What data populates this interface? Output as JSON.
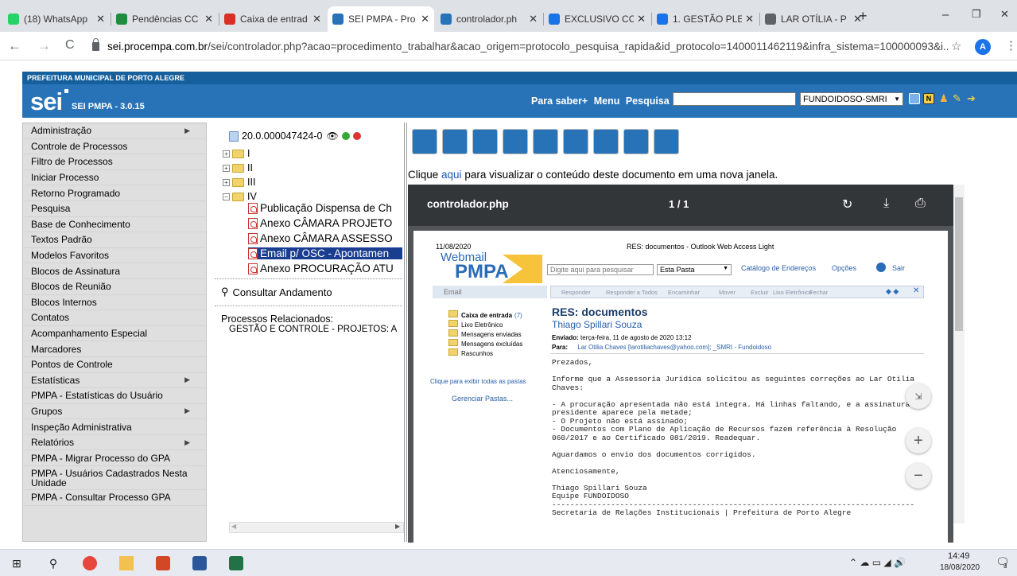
{
  "browser": {
    "tabs": [
      {
        "label": "(18) WhatsApp",
        "icon": "whatsapp-icon",
        "color": "#25d366"
      },
      {
        "label": "Pendências CC",
        "icon": "sheets-icon",
        "color": "#1e8e3e"
      },
      {
        "label": "Caixa de entrad",
        "icon": "gmail-icon",
        "color": "#d93025"
      },
      {
        "label": "SEI PMPA - Pro",
        "icon": "sei-icon",
        "color": "#2873b8"
      },
      {
        "label": "controlador.ph",
        "icon": "sei-icon",
        "color": "#2873b8"
      },
      {
        "label": "EXCLUSIVO CC",
        "icon": "co-icon",
        "color": "#1a73e8"
      },
      {
        "label": "1. GESTÃO PLE",
        "icon": "co-icon",
        "color": "#1a73e8"
      },
      {
        "label": "LAR OTÍLIA - P",
        "icon": "globe-icon",
        "color": "#5f6368"
      }
    ],
    "new_tab": "+",
    "window_controls": [
      "–",
      "❐",
      "✕"
    ],
    "url_host": "sei.procempa.com.br",
    "url_path": "/sei/controlador.php?acao=procedimento_trabalhar&acao_origem=protocolo_pesquisa_rapida&id_protocolo=1400011462119&infra_sistema=100000093&i...",
    "profile_initial": "A"
  },
  "sei": {
    "org": "PREFEITURA MUNICIPAL DE PORTO ALEGRE",
    "logo": "sei",
    "version": "SEI PMPA - 3.0.15",
    "links": [
      "Para saber+",
      "Menu",
      "Pesquisa"
    ],
    "unit": "FUNDOIDOSO-SMRI"
  },
  "menu": [
    {
      "label": "Administração",
      "sub": true
    },
    {
      "label": "Controle de Processos",
      "sub": false
    },
    {
      "label": "Filtro de Processos",
      "sub": false
    },
    {
      "label": "Iniciar Processo",
      "sub": false
    },
    {
      "label": "Retorno Programado",
      "sub": false
    },
    {
      "label": "Pesquisa",
      "sub": false
    },
    {
      "label": "Base de Conhecimento",
      "sub": false
    },
    {
      "label": "Textos Padrão",
      "sub": false
    },
    {
      "label": "Modelos Favoritos",
      "sub": false
    },
    {
      "label": "Blocos de Assinatura",
      "sub": false
    },
    {
      "label": "Blocos de Reunião",
      "sub": false
    },
    {
      "label": "Blocos Internos",
      "sub": false
    },
    {
      "label": "Contatos",
      "sub": false
    },
    {
      "label": "Acompanhamento Especial",
      "sub": false
    },
    {
      "label": "Marcadores",
      "sub": false
    },
    {
      "label": "Pontos de Controle",
      "sub": false
    },
    {
      "label": "Estatísticas",
      "sub": true
    },
    {
      "label": "PMPA - Estatísticas do Usuário",
      "sub": false
    },
    {
      "label": "Grupos",
      "sub": true
    },
    {
      "label": "Inspeção Administrativa",
      "sub": false
    },
    {
      "label": "Relatórios",
      "sub": true
    },
    {
      "label": "PMPA - Migrar Processo do GPA",
      "sub": false
    },
    {
      "label": "PMPA - Usuários Cadastrados Nesta Unidade",
      "sub": false
    },
    {
      "label": "PMPA - Consultar Processo GPA",
      "sub": false
    }
  ],
  "tree": {
    "process": "20.0.000047424-0",
    "folders": [
      "I",
      "II",
      "III",
      "IV"
    ],
    "docs": [
      "Publicação Dispensa de Ch",
      "Anexo CÂMARA PROJETO",
      "Anexo CÂMARA ASSESSO",
      "Email p/ OSC - Apontamen",
      "Anexo PROCURAÇÃO ATU"
    ],
    "consultar": "Consultar Andamento",
    "relacionados_label": "Processos Relacionados:",
    "relacionados_value": "GESTÃO E CONTROLE - PROJETOS: A"
  },
  "viewer": {
    "clique_pre": "Clique ",
    "clique_link": "aqui",
    "clique_post": " para visualizar o conteúdo deste documento em uma nova janela.",
    "title": "controlador.php",
    "page": "1 / 1"
  },
  "email": {
    "date": "11/08/2020",
    "window_title": "RES: documentos - Outlook Web Access Light",
    "logo1": "Webmail",
    "logo2": "PMPA",
    "search_placeholder": "Digite aqui para pesquisar",
    "scope": "Esta Pasta",
    "catalog": "Catálogo de Endereços",
    "options": "Opções",
    "exit": "Sair",
    "side_email": "Email",
    "folders": [
      "Caixa de entrada",
      "Lixo Eletrônico",
      "Mensagens enviadas",
      "Mensagens excluídas",
      "Rascunhos"
    ],
    "inbox_count": "(7)",
    "all_folders": "Clique para exibir todas as pastas",
    "manage": "Gerenciar Pastas...",
    "actions": [
      "Responder",
      "Responder a Todos",
      "Encaminhar",
      "Mover",
      "Excluir",
      "Lixo Eletrônico",
      "Fechar"
    ],
    "subject": "RES: documentos",
    "from": "Thiago Spillari Souza",
    "sent_label": "Enviado:",
    "sent_value": "terça-feira, 11 de agosto de 2020 13:12",
    "to_label": "Para:",
    "to_value": "Lar Otilia Chaves [larotiliachaves@yahoo.com]; _SMRI - Fundoidoso",
    "body": [
      "Prezados,",
      "",
      "Informe que a Assessoria Jurídica solicitou as seguintes correções ao Lar Otilia",
      "Chaves:",
      "",
      "- A procuração apresentada não está integra. Há linhas faltando, e a assinatura",
      "presidente aparece pela metade;",
      "- O Projeto não está assinado;",
      "- Documentos com Plano de Aplicação de Recursos fazem referência à Resolução",
      "060/2017 e ao Certificado 081/2019. Readequar.",
      "",
      "Aguardamos o envio dos documentos corrigidos.",
      "",
      "Atenciosamente,",
      "",
      "Thiago Spillari Souza",
      "Equipe FUNDOIDOSO",
      "--------------------------------------------------------------------------------",
      "Secretaria de Relações Institucionais | Prefeitura de Porto Alegre"
    ]
  },
  "taskbar": {
    "time": "14:49",
    "date": "18/08/2020",
    "notif": "3"
  }
}
